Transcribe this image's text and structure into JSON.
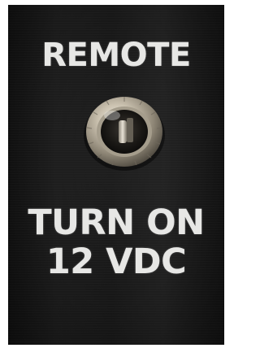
{
  "panel": {
    "label_top": "REMOTE",
    "label_bottom_line1": "TURN ON",
    "label_bottom_line2": "12 VDC",
    "jack_icon": "audio-jack-icon",
    "colors": {
      "panel": "#1a1a1a",
      "text": "#e7e7e5",
      "metal": "#bdb6a8"
    }
  }
}
